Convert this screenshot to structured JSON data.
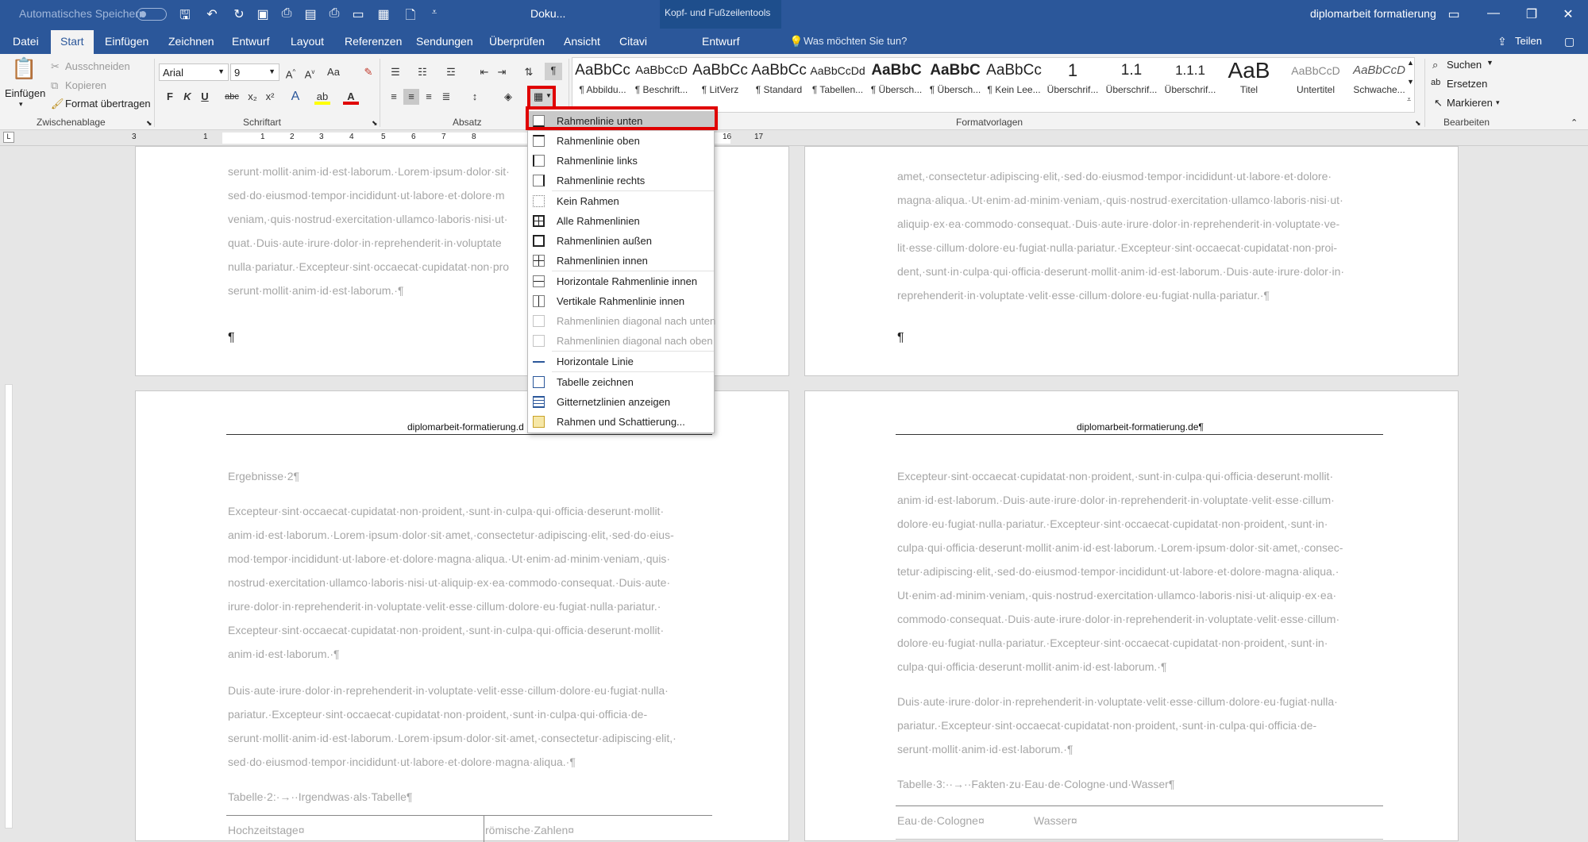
{
  "titlebar": {
    "autosave": "Automatisches Speichern",
    "doc_name": "Doku...",
    "context_group": "Kopf- und Fußzeilentools",
    "app_title": "diplomarbeit formatierung"
  },
  "tabs": [
    "Datei",
    "Start",
    "Einfügen",
    "Zeichnen",
    "Entwurf",
    "Layout",
    "Referenzen",
    "Sendungen",
    "Überprüfen",
    "Ansicht",
    "Citavi"
  ],
  "context_tab": "Entwurf",
  "tell_me": "Was möchten Sie tun?",
  "share": "Teilen",
  "clipboard": {
    "paste": "Einfügen",
    "cut": "Ausschneiden",
    "copy": "Kopieren",
    "format_painter": "Format übertragen",
    "group": "Zwischenablage"
  },
  "font": {
    "name": "Arial",
    "size": "9",
    "bold": "F",
    "italic": "K",
    "underline": "U",
    "strike": "abc",
    "sub": "x₂",
    "sup": "x²",
    "change_case": "Aa",
    "group": "Schriftart"
  },
  "paragraph": {
    "group": "Absatz"
  },
  "styles": {
    "items": [
      {
        "sample": "AaBbCc",
        "name": "¶ Abbildu..."
      },
      {
        "sample": "AaBbCcD",
        "name": "¶ Beschrift..."
      },
      {
        "sample": "AaBbCc",
        "name": "¶ LitVerz"
      },
      {
        "sample": "AaBbCc",
        "name": "¶ Standard"
      },
      {
        "sample": "AaBbCcDd",
        "name": "¶ Tabellen..."
      },
      {
        "sample": "AaBbC",
        "name": "¶ Übersch..."
      },
      {
        "sample": "AaBbC",
        "name": "¶ Übersch..."
      },
      {
        "sample": "AaBbCc",
        "name": "¶ Kein Lee..."
      },
      {
        "sample": "1",
        "name": "Überschrif..."
      },
      {
        "sample": "1.1",
        "name": "Überschrif..."
      },
      {
        "sample": "1.1.1",
        "name": "Überschrif..."
      },
      {
        "sample": "AaB",
        "name": "Titel"
      },
      {
        "sample": "AaBbCcD",
        "name": "Untertitel"
      },
      {
        "sample": "AaBbCcD",
        "name": "Schwache..."
      }
    ],
    "group": "Formatvorlagen"
  },
  "editing": {
    "find": "Suchen",
    "replace": "Ersetzen",
    "select": "Markieren",
    "group": "Bearbeiten"
  },
  "border_menu": [
    {
      "label": "Rahmenlinie unten",
      "disabled": false
    },
    {
      "label": "Rahmenlinie oben",
      "disabled": false
    },
    {
      "label": "Rahmenlinie links",
      "disabled": false
    },
    {
      "label": "Rahmenlinie rechts",
      "disabled": false
    },
    {
      "label": "Kein Rahmen",
      "disabled": false
    },
    {
      "label": "Alle Rahmenlinien",
      "disabled": false
    },
    {
      "label": "Rahmenlinien außen",
      "disabled": false
    },
    {
      "label": "Rahmenlinien innen",
      "disabled": false
    },
    {
      "label": "Horizontale Rahmenlinie innen",
      "disabled": false
    },
    {
      "label": "Vertikale Rahmenlinie innen",
      "disabled": false
    },
    {
      "label": "Rahmenlinien diagonal nach unten",
      "disabled": true
    },
    {
      "label": "Rahmenlinien diagonal nach oben",
      "disabled": true
    },
    {
      "label": "Horizontale Linie",
      "disabled": false
    },
    {
      "label": "Tabelle zeichnen",
      "disabled": false
    },
    {
      "label": "Gitternetzlinien anzeigen",
      "disabled": false
    },
    {
      "label": "Rahmen und Schattierung...",
      "disabled": false
    }
  ],
  "pages": {
    "p1_lines": [
      "serunt·mollit·anim·id·est·laborum.·Lorem·ipsum·dolor·sit·",
      "sed·do·eiusmod·tempor·incididunt·ut·labore·et·dolore·m",
      "veniam,·quis·nostrud·exercitation·ullamco·laboris·nisi·ut·",
      "quat.·Duis·aute·irure·dolor·in·reprehenderit·in·voluptate",
      "nulla·pariatur.·Excepteur·sint·occaecat·cupidatat·non·pro",
      "serunt·mollit·anim·id·est·laborum.·¶"
    ],
    "p2_lines": [
      "amet,·consectetur·adipiscing·elit,·sed·do·eiusmod·tempor·incididunt·ut·labore·et·dolore·",
      "magna·aliqua.·Ut·enim·ad·minim·veniam,·quis·nostrud·exercitation·ullamco·laboris·nisi·ut·",
      "aliquip·ex·ea·commodo·consequat.·Duis·aute·irure·dolor·in·reprehenderit·in·voluptate·ve-",
      "lit·esse·cillum·dolore·eu·fugiat·nulla·pariatur.·Excepteur·sint·occaecat·cupidatat·non·proi-",
      "dent,·sunt·in·culpa·qui·officia·deserunt·mollit·anim·id·est·laborum.·Duis·aute·irure·dolor·in·",
      "reprehenderit·in·voluptate·velit·esse·cillum·dolore·eu·fugiat·nulla·pariatur.·¶"
    ],
    "pilcrow": "¶",
    "p3_header": "diplomarbeit-formatierung.d",
    "p3_heading": "Ergebnisse·2¶",
    "p3_lines": [
      "Excepteur·sint·occaecat·cupidatat·non·proident,·sunt·in·culpa·qui·officia·deserunt·mollit·",
      "anim·id·est·laborum.·Lorem·ipsum·dolor·sit·amet,·consectetur·adipiscing·elit,·sed·do·eius-",
      "mod·tempor·incididunt·ut·labore·et·dolore·magna·aliqua.·Ut·enim·ad·minim·veniam,·quis·",
      "nostrud·exercitation·ullamco·laboris·nisi·ut·aliquip·ex·ea·commodo·consequat.·Duis·aute·",
      "irure·dolor·in·reprehenderit·in·voluptate·velit·esse·cillum·dolore·eu·fugiat·nulla·pariatur.·",
      "Excepteur·sint·occaecat·cupidatat·non·proident,·sunt·in·culpa·qui·officia·deserunt·mollit·",
      "anim·id·est·laborum.·¶"
    ],
    "p3_lines_b": [
      "Duis·aute·irure·dolor·in·reprehenderit·in·voluptate·velit·esse·cillum·dolore·eu·fugiat·nulla·",
      "pariatur.·Excepteur·sint·occaecat·cupidatat·non·proident,·sunt·in·culpa·qui·officia·de-",
      "serunt·mollit·anim·id·est·laborum.·Lorem·ipsum·dolor·sit·amet,·consectetur·adipiscing·elit,·",
      "sed·do·eiusmod·tempor·incididunt·ut·labore·et·dolore·magna·aliqua.·¶"
    ],
    "p3_caption": "Tabelle·2:·→··Irgendwas·als·Tabelle¶",
    "p3_cell1": "Hochzeitstage¤",
    "p3_cell2": "römische·Zahlen¤",
    "p4_header": "diplomarbeit-formatierung.de¶",
    "p4_lines": [
      "Excepteur·sint·occaecat·cupidatat·non·proident,·sunt·in·culpa·qui·officia·deserunt·mollit·",
      "anim·id·est·laborum.·Duis·aute·irure·dolor·in·reprehenderit·in·voluptate·velit·esse·cillum·",
      "dolore·eu·fugiat·nulla·pariatur.·Excepteur·sint·occaecat·cupidatat·non·proident,·sunt·in·",
      "culpa·qui·officia·deserunt·mollit·anim·id·est·laborum.·Lorem·ipsum·dolor·sit·amet,·consec-",
      "tetur·adipiscing·elit,·sed·do·eiusmod·tempor·incididunt·ut·labore·et·dolore·magna·aliqua.·",
      "Ut·enim·ad·minim·veniam,·quis·nostrud·exercitation·ullamco·laboris·nisi·ut·aliquip·ex·ea·",
      "commodo·consequat.·Duis·aute·irure·dolor·in·reprehenderit·in·voluptate·velit·esse·cillum·",
      "dolore·eu·fugiat·nulla·pariatur.·Excepteur·sint·occaecat·cupidatat·non·proident,·sunt·in·",
      "culpa·qui·officia·deserunt·mollit·anim·id·est·laborum.·¶"
    ],
    "p4_lines_b": [
      "Duis·aute·irure·dolor·in·reprehenderit·in·voluptate·velit·esse·cillum·dolore·eu·fugiat·nulla·",
      "pariatur.·Excepteur·sint·occaecat·cupidatat·non·proident,·sunt·in·culpa·qui·officia·de-",
      "serunt·mollit·anim·id·est·laborum.·¶"
    ],
    "p4_caption": "Tabelle·3:··→··Fakten·zu·Eau·de·Cologne·und·Wasser¶",
    "p4_cell1": "Eau·de·Cologne¤",
    "p4_cell2": "Wasser¤"
  },
  "ruler_numbers": [
    "3",
    "1",
    "1",
    "2",
    "3",
    "4",
    "5",
    "6",
    "7",
    "8",
    "16",
    "17"
  ],
  "colors": {
    "accent": "#2b579a",
    "highlight_frame": "#e00000"
  }
}
